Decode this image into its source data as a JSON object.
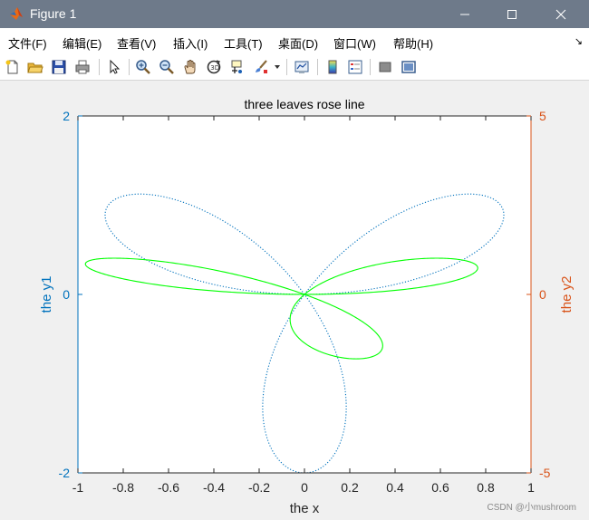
{
  "window": {
    "title": "Figure 1",
    "controls": [
      "minimize",
      "maximize",
      "close"
    ]
  },
  "menu": {
    "items": [
      "文件(F)",
      "编辑(E)",
      "查看(V)",
      "插入(I)",
      "工具(T)",
      "桌面(D)",
      "窗口(W)",
      "帮助(H)"
    ],
    "dock_arrow": "↘"
  },
  "toolbar": {
    "icons": [
      "new-figure-icon",
      "open-file-icon",
      "save-icon",
      "print-icon",
      "pointer-icon",
      "zoom-in-icon",
      "zoom-out-icon",
      "pan-icon",
      "rotate-3d-icon",
      "data-cursor-icon",
      "brush-icon",
      "brush-dropdown-icon",
      "link-plot-icon",
      "colorbar-icon",
      "legend-icon",
      "hide-plot-tools-icon",
      "show-plot-tools-icon"
    ]
  },
  "chart_data": {
    "type": "line",
    "title": "three leaves rose line",
    "xlabel": "the x",
    "ylabel_left": "the y1",
    "ylabel_right": "the y2",
    "xlim": [
      -1,
      1
    ],
    "ylim_left": [
      -2,
      2
    ],
    "ylim_right": [
      -5,
      5
    ],
    "x_ticks": [
      "-1",
      "-0.8",
      "-0.6",
      "-0.4",
      "-0.2",
      "0",
      "0.2",
      "0.4",
      "0.6",
      "0.8",
      "1"
    ],
    "y_left_ticks": [
      "-2",
      "0",
      "2"
    ],
    "y_right_ticks": [
      "-5",
      "0",
      "5"
    ],
    "colors": {
      "left_axis": "#0072bd",
      "right_axis": "#d95319",
      "series_left": "#0072bd",
      "series_right": "#00ff00"
    },
    "series": [
      {
        "axis": "left",
        "style": "dotted",
        "equation": "r = sin(3θ); x = r·cos θ; y = 2·r·sin θ",
        "lobe_tips": [
          [
            0.75,
            0.866
          ],
          [
            -0.75,
            0.866
          ],
          [
            0,
            -2
          ]
        ]
      },
      {
        "axis": "right",
        "style": "solid",
        "equation": "r = sin(3θ); x = r·cos θ; y = 5·r·sin θ",
        "lobe_tips": [
          [
            0.75,
            1.6
          ],
          [
            -0.75,
            1.6
          ],
          [
            -0.18,
            -1.8
          ]
        ]
      }
    ]
  },
  "watermark": "CSDN @小mushroom"
}
